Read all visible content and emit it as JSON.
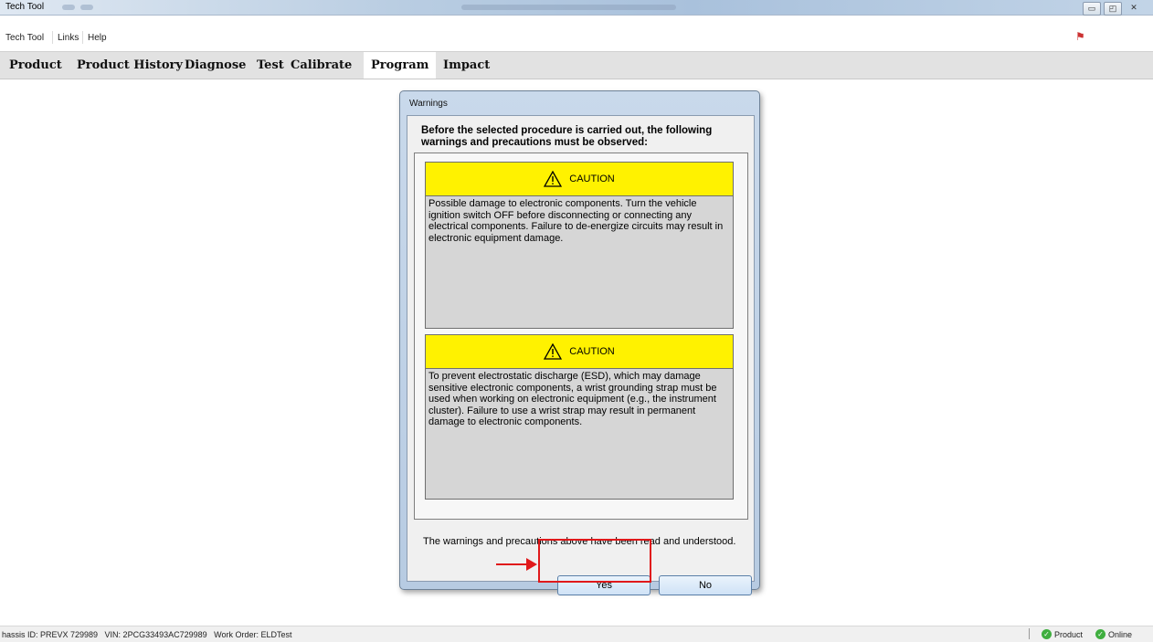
{
  "window": {
    "title": "Tech Tool",
    "controls": [
      "minimize-icon",
      "restore-icon",
      "close-icon"
    ]
  },
  "menu": {
    "items": [
      "Tech Tool",
      "Links",
      "Help"
    ],
    "notification_icon": "alert-icon"
  },
  "nav": {
    "tabs": [
      "Product",
      "Product History",
      "Diagnose",
      "Test",
      "Calibrate",
      "Program",
      "Impact"
    ],
    "active": "Program"
  },
  "dialog": {
    "title": "Warnings",
    "header": "Before the selected procedure is carried out, the following warnings and precautions must be observed:",
    "cautions": [
      {
        "label": "CAUTION",
        "icon": "warning-triangle-icon",
        "text": "Possible damage to electronic components. Turn the vehicle ignition switch OFF before disconnecting or connecting any electrical components. Failure to de-energize circuits may result in electronic equipment damage."
      },
      {
        "label": "CAUTION",
        "icon": "warning-triangle-icon",
        "text": "To prevent electrostatic discharge (ESD), which may damage sensitive electronic components, a wrist grounding strap must be used when working on electronic equipment (e.g., the instrument cluster). Failure to use a wrist strap may result in permanent damage to electronic components."
      }
    ],
    "confirmation": "The warnings and precautions above have been read and understood.",
    "yes_label": "Yes",
    "no_label": "No"
  },
  "status": {
    "left": "hassis ID: PREVX 729989   VIN: 2PCG33493AC729989   Work Order: ELDTest",
    "product_label": "Product",
    "online_label": "Online"
  },
  "colors": {
    "caution_header": "#fff200",
    "annotation_red": "#e0191b",
    "nav_bg": "#e2e2e2",
    "dialog_frame": "#b7cbe2"
  }
}
